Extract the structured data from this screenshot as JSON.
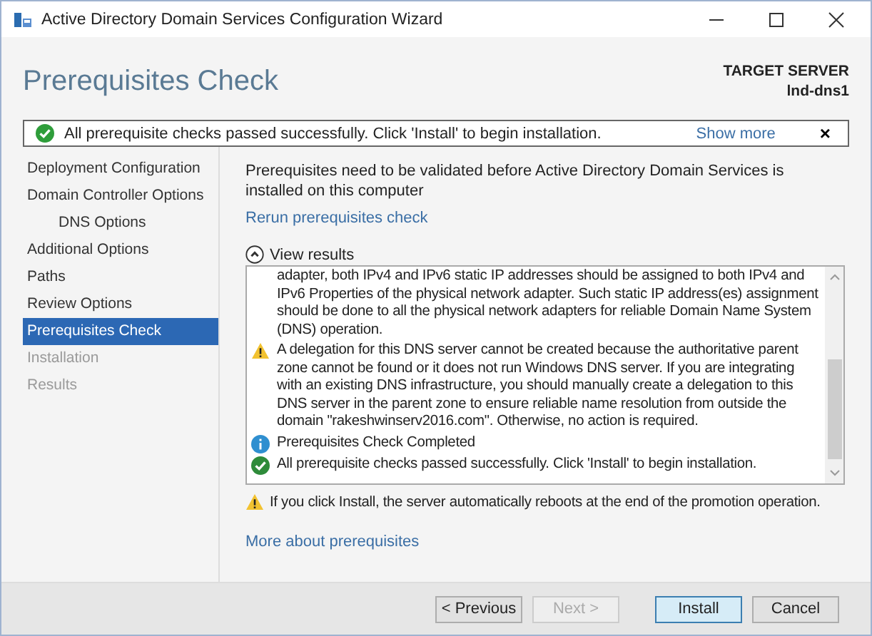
{
  "window": {
    "title": "Active Directory Domain Services Configuration Wizard"
  },
  "header": {
    "title": "Prerequisites Check",
    "target_label": "TARGET SERVER",
    "target_name": "lnd-dns1"
  },
  "banner": {
    "kind": "success",
    "text": "All prerequisite checks passed successfully.  Click 'Install' to begin installation.",
    "link": "Show more",
    "close": "×"
  },
  "sidebar": {
    "items": [
      {
        "label": "Deployment Configuration",
        "selected": false,
        "disabled": false
      },
      {
        "label": "Domain Controller Options",
        "selected": false,
        "disabled": false,
        "children": [
          {
            "label": "DNS Options",
            "selected": false,
            "disabled": false
          }
        ]
      },
      {
        "label": "Additional Options",
        "selected": false,
        "disabled": false
      },
      {
        "label": "Paths",
        "selected": false,
        "disabled": false
      },
      {
        "label": "Review Options",
        "selected": false,
        "disabled": false
      },
      {
        "label": "Prerequisites Check",
        "selected": true,
        "disabled": false
      },
      {
        "label": "Installation",
        "selected": false,
        "disabled": true
      },
      {
        "label": "Results",
        "selected": false,
        "disabled": true
      }
    ]
  },
  "content": {
    "intro": "Prerequisites need to be validated before Active Directory Domain Services is installed on this computer",
    "rerun_link": "Rerun prerequisites check",
    "results_toggle": {
      "label": "View results",
      "expanded": true
    },
    "results": [
      {
        "kind": "text",
        "text": "adapter, both IPv4 and IPv6 static IP addresses should be assigned to both IPv4 and IPv6 Properties of the physical network adapter. Such static IP address(es) assignment should be done to all the physical network adapters for reliable Domain Name System (DNS) operation."
      },
      {
        "kind": "warning",
        "text": "A delegation for this DNS server cannot be created because the authoritative parent zone cannot be found or it does not run Windows DNS server. If you are integrating with an existing DNS infrastructure, you should manually create a delegation to this DNS server in the parent zone to ensure reliable name resolution from outside the domain \"rakeshwinserv2016.com\". Otherwise, no action is required."
      },
      {
        "kind": "info",
        "text": "Prerequisites Check Completed"
      },
      {
        "kind": "success",
        "text": "All prerequisite checks passed successfully.  Click 'Install' to begin installation."
      }
    ],
    "notice": {
      "kind": "warning",
      "text": "If you click Install, the server automatically reboots at the end of the promotion operation."
    },
    "more_link": "More about prerequisites"
  },
  "buttons": [
    {
      "label": "< Previous",
      "disabled": false,
      "focused": false
    },
    {
      "label": "Next >",
      "disabled": true,
      "focused": false
    },
    {
      "label": "Install",
      "disabled": false,
      "focused": true
    },
    {
      "label": "Cancel",
      "disabled": false,
      "focused": false
    }
  ]
}
